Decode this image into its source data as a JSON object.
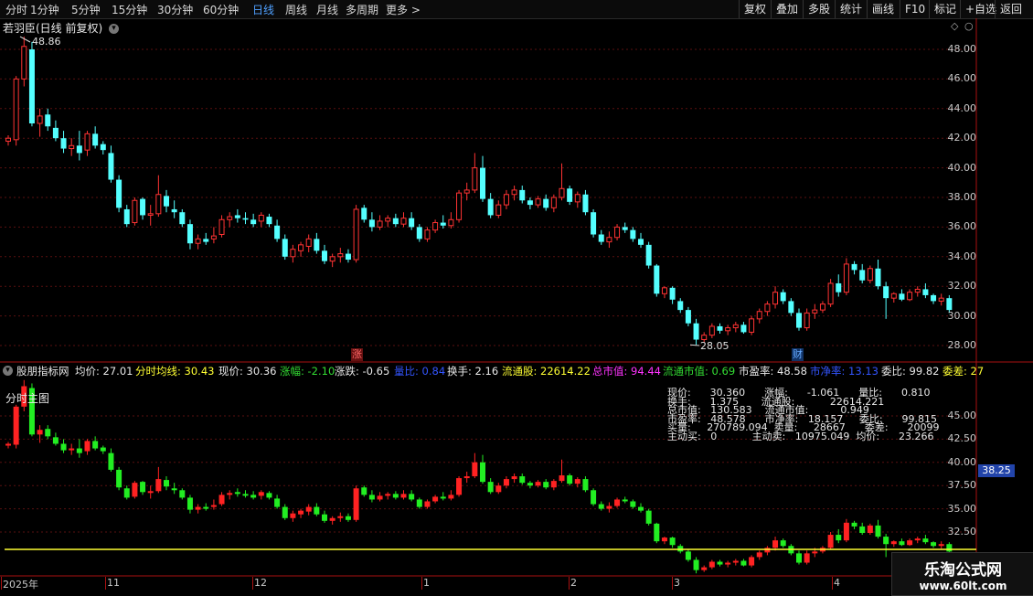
{
  "toolbar": {
    "periods": [
      "分时",
      "1分钟",
      "5分钟",
      "15分钟",
      "30分钟",
      "60分钟",
      "日线",
      "周线",
      "月线",
      "多周期",
      "更多 >"
    ],
    "active_period": "日线",
    "buttons": [
      "复权",
      "叠加",
      "多股",
      "统计",
      "画线",
      "F10",
      "标记",
      "+自选",
      "返回"
    ]
  },
  "main_panel": {
    "title": "若羽臣(日线 前复权)",
    "price_axis": [
      "48.00",
      "46.00",
      "44.00",
      "42.00",
      "40.00",
      "38.00",
      "36.00",
      "34.00",
      "32.00",
      "30.00",
      "28.00"
    ],
    "high_label": "48.86",
    "low_label": "28.05",
    "event_marks": [
      "涨",
      "财"
    ]
  },
  "indicator_bar": {
    "name": "股朋指标网",
    "items": [
      {
        "label": "均价: 27.01",
        "color": "#e8e8e8"
      },
      {
        "label": "分时均线: 30.43",
        "color": "#ffff33"
      },
      {
        "label": "现价: 30.36",
        "color": "#e8e8e8"
      },
      {
        "label": "涨幅: -2.10",
        "color": "#33dd33"
      },
      {
        "label": "涨跌: -0.65",
        "color": "#e8e8e8"
      },
      {
        "label": "量比: 0.84",
        "color": "#3355ff"
      },
      {
        "label": "换手: 2.16",
        "color": "#e8e8e8"
      },
      {
        "label": "流通股: 22614.22",
        "color": "#ffff33"
      },
      {
        "label": "总市值: 94.44",
        "color": "#ff33ff"
      },
      {
        "label": "流通市值: 0.69",
        "color": "#33dd33"
      },
      {
        "label": "市盈率: 48.58",
        "color": "#e8e8e8"
      },
      {
        "label": "市净率: 13.13",
        "color": "#3355ff"
      },
      {
        "label": "委比: 99.82",
        "color": "#e8e8e8"
      },
      {
        "label": "委差: 27",
        "color": "#ffff33"
      }
    ]
  },
  "sub_panel": {
    "title": "分时主图",
    "price_axis": [
      "45.00",
      "42.50",
      "40.00",
      "37.50",
      "35.00",
      "32.50"
    ],
    "highlight_value": "38.25",
    "info_lines": [
      "现价:      30.360      涨幅:      -1.061      量比:      0.810",
      "换手:      1.375       流通股:           22614.221",
      "总市值:   130.583    流通市值:          0.949",
      "市盈率:   48.578      市净率:   18.157     委比:      99.815",
      "买量:     270789.094  卖量:     28667      委差:      20099",
      "主动买:   0           主动卖:   10975.049  均价:      23.266"
    ]
  },
  "time_axis": [
    "2025年",
    "11",
    "12",
    "1",
    "2",
    "3",
    "4"
  ],
  "watermark": {
    "title": "乐淘公式网",
    "url": "www.60lt.com"
  },
  "colors": {
    "up": "#ff3333",
    "down": "#54ffff",
    "sub_up": "#ff2222",
    "sub_down": "#22ee22",
    "line": "#ffff33"
  },
  "chart_data": {
    "type": "candlestick",
    "title": "若羽臣(日线 前复权)",
    "ylim": [
      27,
      49.5
    ],
    "values": [
      [
        41.8,
        42.2,
        41.5,
        42.0
      ],
      [
        41.9,
        46.2,
        41.5,
        46.0
      ],
      [
        46.0,
        48.86,
        45.5,
        48.2
      ],
      [
        48.0,
        48.5,
        42.8,
        43.0
      ],
      [
        43.0,
        44.0,
        42.1,
        43.5
      ],
      [
        43.6,
        44.0,
        42.5,
        42.8
      ],
      [
        42.7,
        43.2,
        41.8,
        42.0
      ],
      [
        42.0,
        42.5,
        41.0,
        41.3
      ],
      [
        41.3,
        42.0,
        40.8,
        41.5
      ],
      [
        41.5,
        42.5,
        40.5,
        41.0
      ],
      [
        41.2,
        42.5,
        40.8,
        42.3
      ],
      [
        42.3,
        42.8,
        41.3,
        41.5
      ],
      [
        41.6,
        41.8,
        40.9,
        41.2
      ],
      [
        41.0,
        41.5,
        39.0,
        39.2
      ],
      [
        39.2,
        39.5,
        37.0,
        37.3
      ],
      [
        37.2,
        37.5,
        36.0,
        36.2
      ],
      [
        36.3,
        38.0,
        36.1,
        37.8
      ],
      [
        37.9,
        38.0,
        36.5,
        36.8
      ],
      [
        36.8,
        37.5,
        36.1,
        36.9
      ],
      [
        36.9,
        39.5,
        36.7,
        38.2
      ],
      [
        38.1,
        38.5,
        37.0,
        37.4
      ],
      [
        37.2,
        37.8,
        36.6,
        37.0
      ],
      [
        37.0,
        37.2,
        36.0,
        36.2
      ],
      [
        36.2,
        36.5,
        34.5,
        34.9
      ],
      [
        34.9,
        35.5,
        34.5,
        35.2
      ],
      [
        35.2,
        35.6,
        34.8,
        35.0
      ],
      [
        35.2,
        36.0,
        34.9,
        35.4
      ],
      [
        35.5,
        36.8,
        35.3,
        36.5
      ],
      [
        36.5,
        37.0,
        36.0,
        36.7
      ],
      [
        36.8,
        37.2,
        36.3,
        36.6
      ],
      [
        36.6,
        37.0,
        36.2,
        36.5
      ],
      [
        36.5,
        36.9,
        36.0,
        36.2
      ],
      [
        36.4,
        37.0,
        36.0,
        36.8
      ],
      [
        36.7,
        36.9,
        36.0,
        36.2
      ],
      [
        36.1,
        36.5,
        35.0,
        35.2
      ],
      [
        35.2,
        35.5,
        33.8,
        34.0
      ],
      [
        34.0,
        34.8,
        33.6,
        34.5
      ],
      [
        34.4,
        35.0,
        34.0,
        34.8
      ],
      [
        34.7,
        35.5,
        34.3,
        35.2
      ],
      [
        35.2,
        35.6,
        34.2,
        34.4
      ],
      [
        34.4,
        34.8,
        33.5,
        33.7
      ],
      [
        33.7,
        34.2,
        33.3,
        34.0
      ],
      [
        34.0,
        34.6,
        33.6,
        34.2
      ],
      [
        34.2,
        34.5,
        33.6,
        33.8
      ],
      [
        33.8,
        37.5,
        33.6,
        37.2
      ],
      [
        37.3,
        37.5,
        36.3,
        36.5
      ],
      [
        36.5,
        37.0,
        35.7,
        36.0
      ],
      [
        36.0,
        36.8,
        35.8,
        36.4
      ],
      [
        36.4,
        36.8,
        36.0,
        36.6
      ],
      [
        36.6,
        36.9,
        36.0,
        36.2
      ],
      [
        36.2,
        37.0,
        36.0,
        36.6
      ],
      [
        36.6,
        37.0,
        35.8,
        36.0
      ],
      [
        36.0,
        36.2,
        35.0,
        35.2
      ],
      [
        35.2,
        36.0,
        35.0,
        35.8
      ],
      [
        35.8,
        36.5,
        35.6,
        36.3
      ],
      [
        36.3,
        36.8,
        35.9,
        36.1
      ],
      [
        36.1,
        37.0,
        35.9,
        36.5
      ],
      [
        36.5,
        38.5,
        36.3,
        38.3
      ],
      [
        38.3,
        39.0,
        37.8,
        38.5
      ],
      [
        38.5,
        41.0,
        38.3,
        40.0
      ],
      [
        40.0,
        40.8,
        37.7,
        37.9
      ],
      [
        37.9,
        38.3,
        36.6,
        36.8
      ],
      [
        36.8,
        37.8,
        36.6,
        37.5
      ],
      [
        37.5,
        38.5,
        37.2,
        38.2
      ],
      [
        38.2,
        38.8,
        37.8,
        38.5
      ],
      [
        38.5,
        38.8,
        37.6,
        37.8
      ],
      [
        37.8,
        38.0,
        37.2,
        37.5
      ],
      [
        37.5,
        38.1,
        37.3,
        37.9
      ],
      [
        37.9,
        38.2,
        37.1,
        37.3
      ],
      [
        37.3,
        38.2,
        37.0,
        38.0
      ],
      [
        38.0,
        40.3,
        37.8,
        38.6
      ],
      [
        38.6,
        38.8,
        37.5,
        37.7
      ],
      [
        37.7,
        38.4,
        37.3,
        38.2
      ],
      [
        38.2,
        38.5,
        36.8,
        37.0
      ],
      [
        37.0,
        37.2,
        35.3,
        35.5
      ],
      [
        35.5,
        35.8,
        34.8,
        35.0
      ],
      [
        35.0,
        35.7,
        34.6,
        35.3
      ],
      [
        35.3,
        36.2,
        35.1,
        36.0
      ],
      [
        36.0,
        36.3,
        35.6,
        35.8
      ],
      [
        35.8,
        36.0,
        35.0,
        35.2
      ],
      [
        35.2,
        35.6,
        34.6,
        34.8
      ],
      [
        34.8,
        35.0,
        33.2,
        33.4
      ],
      [
        33.4,
        33.5,
        31.3,
        31.5
      ],
      [
        31.5,
        32.0,
        31.2,
        31.9
      ],
      [
        31.9,
        32.0,
        30.8,
        31.1
      ],
      [
        31.0,
        31.2,
        30.2,
        30.4
      ],
      [
        30.4,
        30.6,
        29.3,
        29.5
      ],
      [
        29.5,
        29.8,
        28.05,
        28.4
      ],
      [
        28.4,
        28.9,
        28.2,
        28.7
      ],
      [
        28.7,
        29.5,
        28.5,
        29.3
      ],
      [
        29.3,
        29.5,
        28.8,
        29.0
      ],
      [
        29.0,
        29.4,
        28.7,
        29.2
      ],
      [
        29.2,
        29.6,
        28.9,
        29.4
      ],
      [
        29.4,
        29.6,
        28.8,
        28.9
      ],
      [
        28.9,
        30.0,
        28.7,
        29.8
      ],
      [
        29.8,
        30.5,
        29.5,
        30.3
      ],
      [
        30.3,
        31.0,
        30.0,
        30.8
      ],
      [
        30.8,
        32.0,
        30.5,
        31.6
      ],
      [
        31.6,
        31.8,
        30.8,
        31.0
      ],
      [
        31.0,
        31.2,
        30.0,
        30.2
      ],
      [
        30.2,
        30.5,
        29.0,
        29.2
      ],
      [
        29.2,
        30.5,
        29.0,
        30.2
      ],
      [
        30.2,
        30.8,
        29.8,
        30.4
      ],
      [
        30.4,
        31.0,
        30.2,
        30.8
      ],
      [
        30.8,
        32.5,
        30.6,
        32.2
      ],
      [
        32.2,
        32.8,
        31.3,
        31.6
      ],
      [
        31.6,
        33.9,
        31.4,
        33.5
      ],
      [
        33.5,
        33.7,
        32.8,
        33.1
      ],
      [
        33.1,
        33.5,
        32.2,
        32.4
      ],
      [
        32.4,
        33.4,
        32.2,
        33.2
      ],
      [
        33.2,
        33.8,
        31.8,
        32.0
      ],
      [
        32.0,
        32.3,
        29.8,
        31.2
      ],
      [
        31.2,
        31.6,
        30.9,
        31.5
      ],
      [
        31.5,
        31.8,
        31.0,
        31.1
      ],
      [
        31.1,
        31.8,
        31.0,
        31.6
      ],
      [
        31.6,
        32.0,
        31.3,
        31.8
      ],
      [
        31.8,
        32.2,
        31.2,
        31.4
      ],
      [
        31.4,
        31.5,
        30.8,
        31.0
      ],
      [
        31.0,
        31.5,
        30.7,
        31.2
      ],
      [
        31.2,
        31.4,
        30.2,
        30.4
      ]
    ]
  }
}
